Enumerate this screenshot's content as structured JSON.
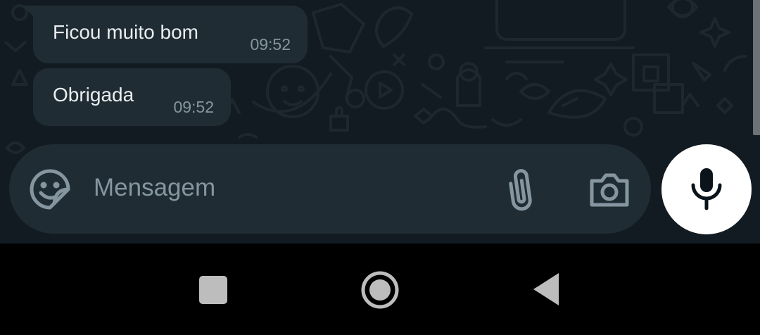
{
  "messages": [
    {
      "text": "Ficou muito bom",
      "time": "09:52"
    },
    {
      "text": "Obrigada",
      "time": "09:52"
    }
  ],
  "composer": {
    "placeholder": "Mensagem",
    "emoji_icon": "sticker-emoji-icon",
    "attach_icon": "paperclip-icon",
    "camera_icon": "camera-icon",
    "mic_icon": "microphone-icon"
  },
  "navigation": {
    "recent_icon": "square-recents-icon",
    "home_icon": "circle-home-icon",
    "back_icon": "triangle-back-icon"
  },
  "colors": {
    "chat_background": "#121b22",
    "bubble": "#202c33",
    "input_bar": "#1f2c33",
    "mic_button": "#ffffff",
    "text_primary": "#e9edef",
    "text_secondary": "#8696a0"
  }
}
